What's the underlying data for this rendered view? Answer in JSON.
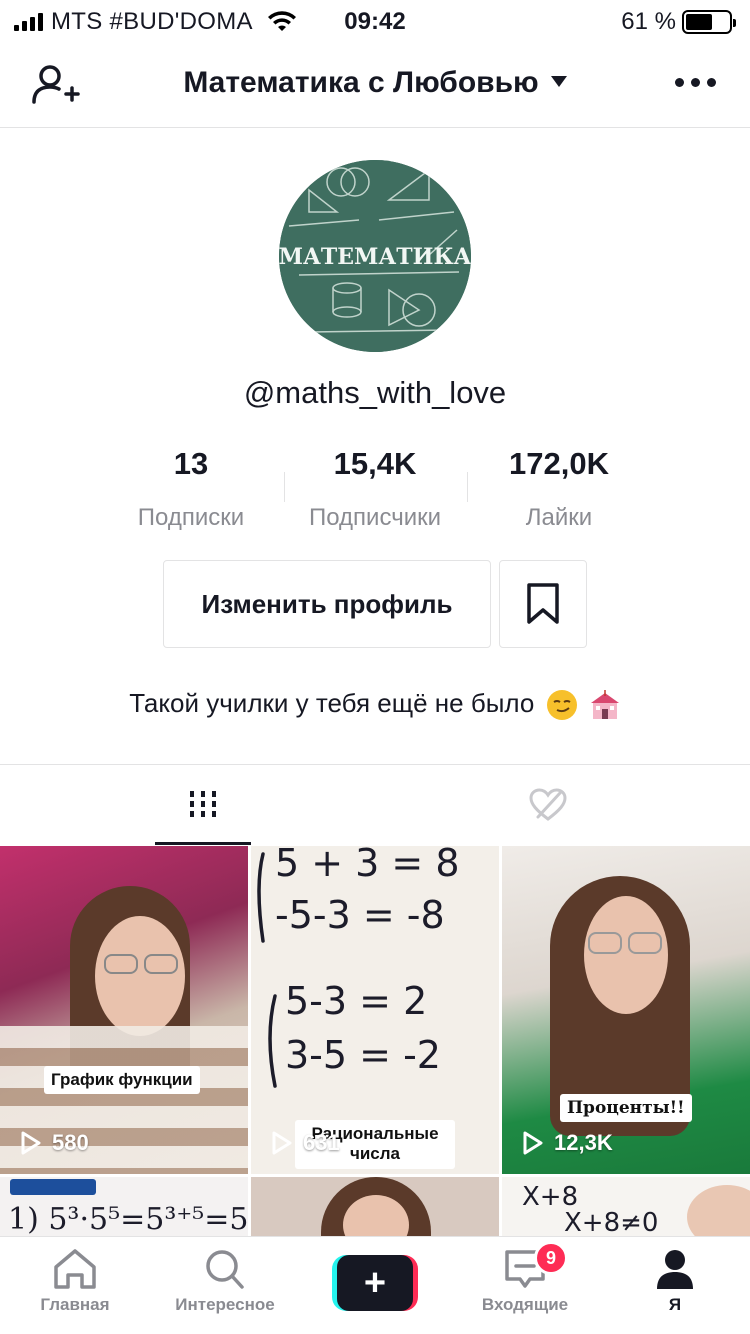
{
  "status_bar": {
    "carrier": "MTS #BUD'DOMA",
    "time": "09:42",
    "battery": "61 %",
    "battery_level": 0.61
  },
  "header": {
    "title": "Математика с Любовью"
  },
  "profile": {
    "avatar_text": "МАТЕМАТИКА",
    "username": "@maths_with_love",
    "bio": "Такой училки у тебя ещё не было"
  },
  "stats": [
    {
      "value": "13",
      "label": "Подписки"
    },
    {
      "value": "15,4K",
      "label": "Подписчики"
    },
    {
      "value": "172,0K",
      "label": "Лайки"
    }
  ],
  "buttons": {
    "edit_profile": "Изменить профиль"
  },
  "videos": [
    {
      "caption": "График функции",
      "views": "580"
    },
    {
      "caption": "Рациональные числа",
      "views": "631"
    },
    {
      "caption": "Проценты!!",
      "views": "12,3K"
    },
    {
      "caption": "",
      "views": ""
    },
    {
      "caption": "",
      "views": ""
    },
    {
      "caption": "",
      "views": ""
    }
  ],
  "bottom_nav": {
    "home": "Главная",
    "discover": "Интересное",
    "create": "+",
    "inbox": "Входящие",
    "inbox_badge": "9",
    "me": "Я"
  },
  "colors": {
    "accent_red": "#fe2c55",
    "accent_cyan": "#25f4ee",
    "text": "#161823",
    "secondary": "#8a8b91"
  }
}
